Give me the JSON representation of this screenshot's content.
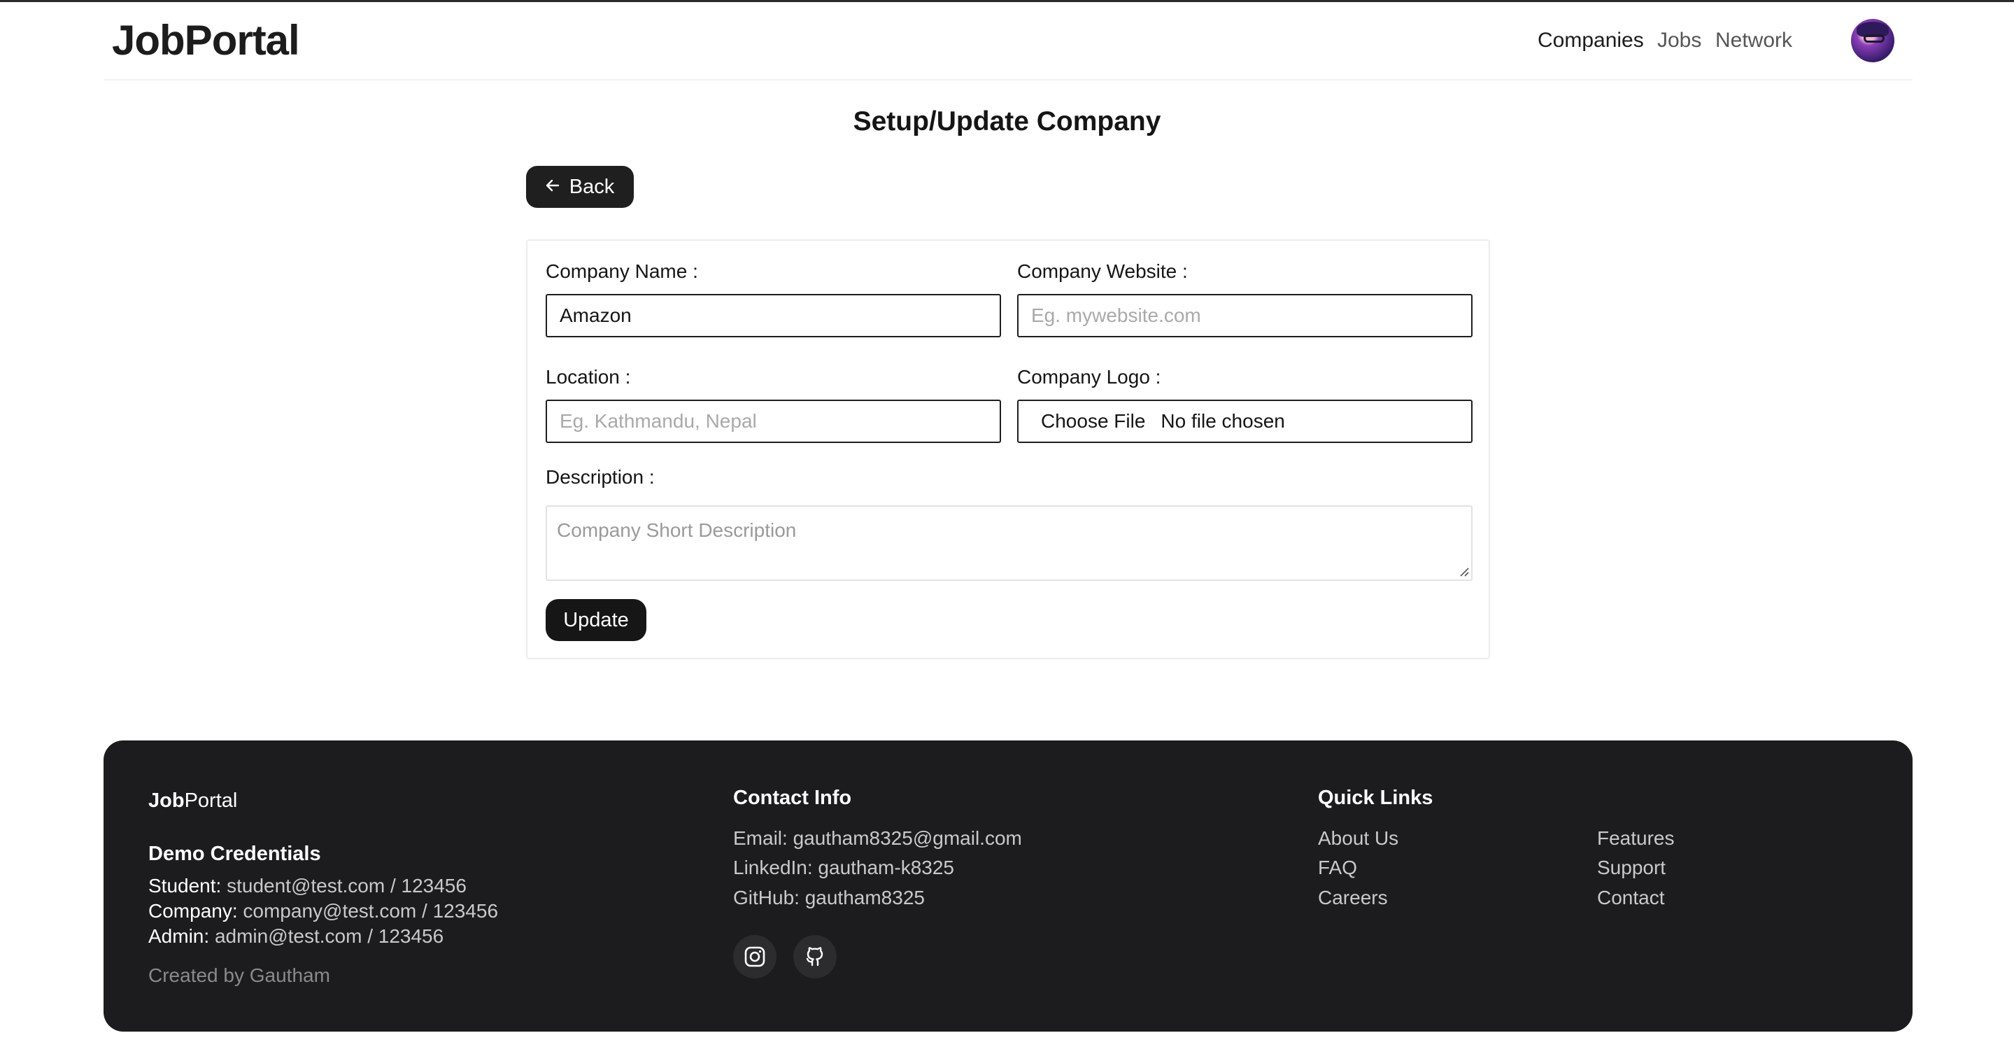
{
  "navbar": {
    "brand": "JobPortal",
    "links": [
      {
        "label": "Companies",
        "active": true
      },
      {
        "label": "Jobs",
        "active": false
      },
      {
        "label": "Network",
        "active": false
      }
    ],
    "avatar_icon": "user-avatar"
  },
  "page": {
    "title": "Setup/Update Company",
    "back_label": "Back",
    "back_icon": "arrow-left-icon"
  },
  "form": {
    "company_name": {
      "label": "Company Name :",
      "value": "Amazon",
      "placeholder": ""
    },
    "company_website": {
      "label": "Company Website :",
      "value": "",
      "placeholder": "Eg. mywebsite.com"
    },
    "location": {
      "label": "Location :",
      "value": "",
      "placeholder": "Eg. Kathmandu, Nepal"
    },
    "company_logo": {
      "label": "Company Logo :",
      "button_label": "Choose File",
      "status": "No file chosen"
    },
    "description": {
      "label": "Description :",
      "value": "",
      "placeholder": "Company Short Description"
    },
    "submit_label": "Update"
  },
  "footer": {
    "brand_bold": "Job",
    "brand_rest": "Portal",
    "demo": {
      "heading": "Demo Credentials",
      "student_key": "Student:",
      "student_value": "student@test.com / 123456",
      "company_key": "Company:",
      "company_value": "company@test.com / 123456",
      "admin_key": "Admin:",
      "admin_value": "admin@test.com / 123456",
      "created_by": "Created by Gautham"
    },
    "contact": {
      "heading": "Contact Info",
      "email": "Email: gautham8325@gmail.com",
      "linkedin": "LinkedIn: gautham-k8325",
      "github": "GitHub: gautham8325",
      "social_icons": [
        "instagram-icon",
        "github-icon"
      ]
    },
    "quick_links": {
      "heading": "Quick Links",
      "col1": [
        "About Us",
        "FAQ",
        "Careers"
      ],
      "col2": [
        "Features",
        "Support",
        "Contact"
      ]
    }
  },
  "colors": {
    "primary_dark": "#1f1f1f",
    "footer_bg": "#1c1b1d",
    "muted_text": "#8a8a8a"
  }
}
